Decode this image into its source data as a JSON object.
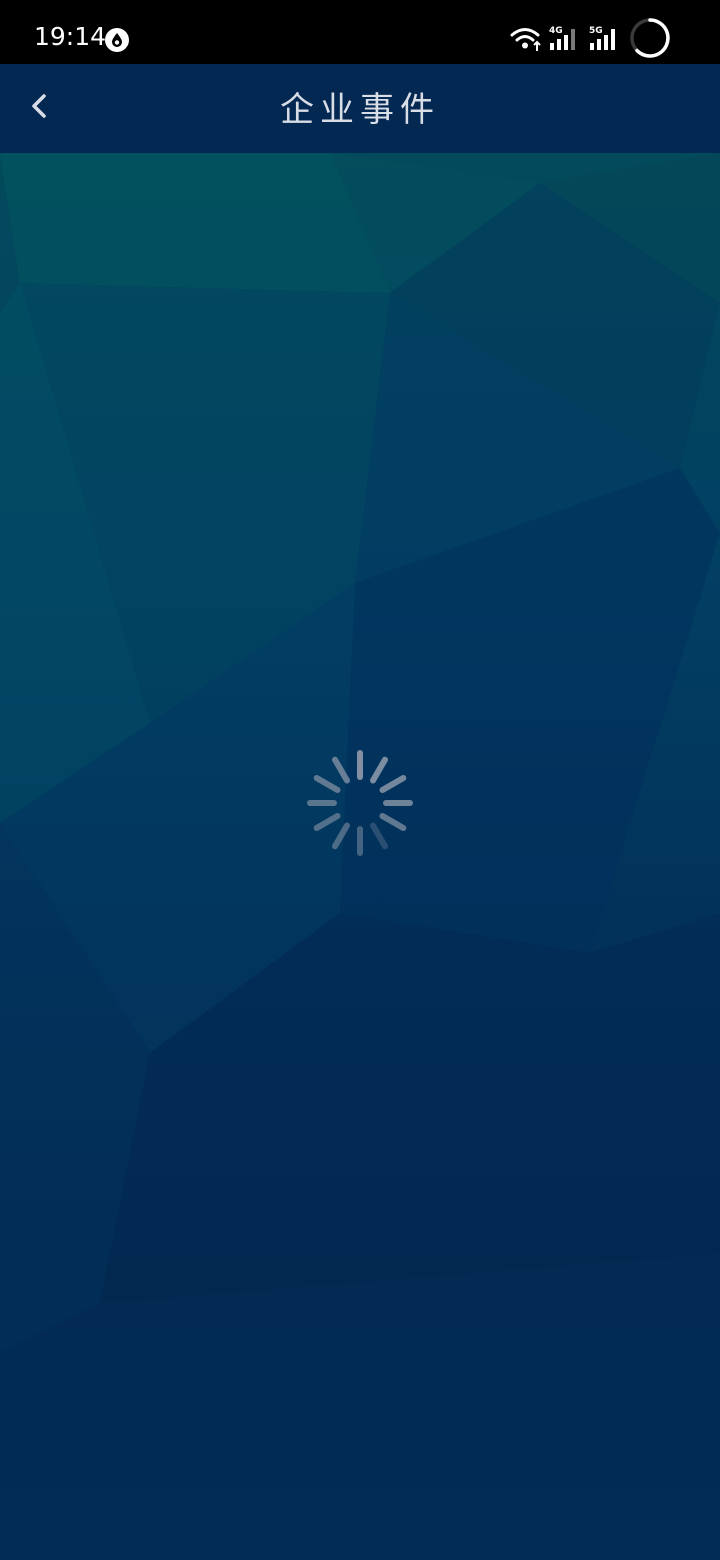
{
  "status_bar": {
    "time": "19:14",
    "app_icon": "droplet-app-icon",
    "wifi_icon": "wifi-icon",
    "signal_4g_label": "4G",
    "signal_5g_label": "5G",
    "battery_icon": "battery-ring-icon"
  },
  "header": {
    "back_icon": "chevron-left-icon",
    "title": "企业事件"
  },
  "content": {
    "loading_icon": "loading-spinner-icon"
  },
  "colors": {
    "status_bar_bg": "#000000",
    "header_bg": "#032852",
    "content_top": "#034a5c",
    "content_bottom": "#022c55",
    "title_text": "#d8dde6",
    "spinner": "#8a96a8"
  }
}
